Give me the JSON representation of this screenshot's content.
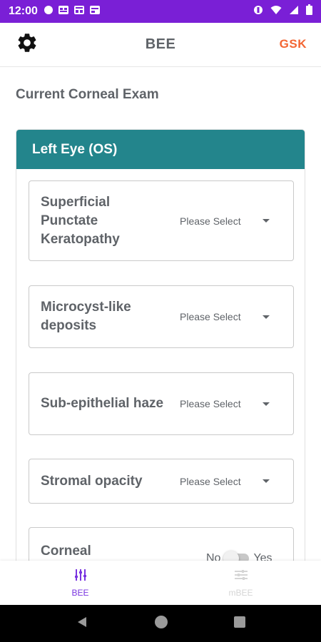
{
  "status_bar": {
    "time": "12:00",
    "left_icons": [
      "circle-notification-icon",
      "image-notification-icon",
      "calendar-notification-icon",
      "image-notification-icon"
    ],
    "right_icons": [
      "dnd-icon",
      "wifi-icon",
      "signal-icon",
      "battery-icon"
    ]
  },
  "app_bar": {
    "title": "BEE",
    "brand": "GSK",
    "settings_icon": "gear-icon"
  },
  "main": {
    "heading": "Current Corneal Exam",
    "panel_title": "Left Eye (OS)",
    "fields": [
      {
        "label": "Superficial Punctate Keratopathy",
        "value": "Please Select"
      },
      {
        "label": "Microcyst-like deposits",
        "value": "Please Select"
      },
      {
        "label": "Sub-epithelial haze",
        "value": "Please Select"
      },
      {
        "label": "Stromal opacity",
        "value": "Please Select"
      }
    ],
    "toggle_field": {
      "label": "Corneal",
      "no_label": "No",
      "yes_label": "Yes",
      "value": false
    }
  },
  "bottom_nav": {
    "items": [
      {
        "label": "BEE",
        "icon": "tune-icon",
        "active": true
      },
      {
        "label": "mBEE",
        "icon": "tune-icon",
        "active": false
      }
    ]
  },
  "system_nav": [
    "back-icon",
    "home-icon",
    "recents-icon"
  ],
  "colors": {
    "status_bar": "#7a1fd6",
    "panel_header": "#23858c",
    "brand": "#f36633",
    "active_nav": "#7a35e0"
  }
}
